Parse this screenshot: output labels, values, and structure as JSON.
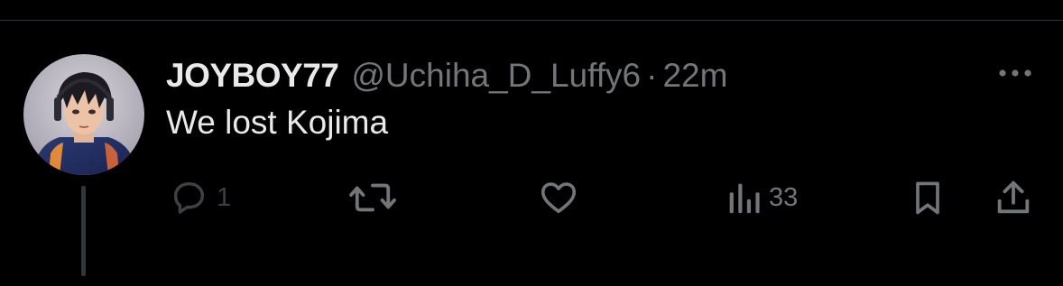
{
  "tweet": {
    "display_name": "JOYBOY77",
    "handle": "@Uchiha_D_Luffy6",
    "separator": "·",
    "time": "22m",
    "text": "We lost Kojima"
  },
  "actions": {
    "replies": "1",
    "views": "33"
  },
  "icons": {
    "avatar": "anime-avatar",
    "more": "more-horizontal-icon",
    "reply": "reply-icon",
    "retweet": "retweet-icon",
    "like": "heart-icon",
    "views": "views-bar-chart-icon",
    "bookmark": "bookmark-icon",
    "share": "share-icon"
  },
  "colors": {
    "background": "#000000",
    "primary_text": "#e7e9ea",
    "secondary_text": "#71767b"
  }
}
